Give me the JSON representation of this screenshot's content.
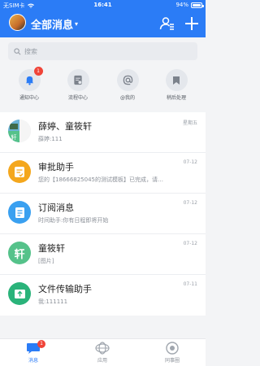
{
  "status_bar": {
    "carrier": "无SIM卡",
    "time": "16:41",
    "battery": "94%"
  },
  "header": {
    "title": "全部消息"
  },
  "search": {
    "placeholder": "搜索"
  },
  "shortcuts": [
    {
      "label": "通知中心",
      "badge": "1",
      "icon": "bell-icon"
    },
    {
      "label": "流程中心",
      "badge": "",
      "icon": "document-icon"
    },
    {
      "label": "@我的",
      "badge": "",
      "icon": "at-icon"
    },
    {
      "label": "稍后处理",
      "badge": "",
      "icon": "bookmark-icon"
    }
  ],
  "conversations": [
    {
      "name": "薛婷、童筱轩",
      "preview": "薛婷:111",
      "time": "星期五",
      "icon": "group-avatar"
    },
    {
      "name": "审批助手",
      "preview": "您的【18666825045的测试模板】已完成，请…",
      "time": "07-12",
      "icon": "approval-icon",
      "color": "#f4a71d"
    },
    {
      "name": "订阅消息",
      "preview": "时间助手:你有日程即将开始",
      "time": "07-12",
      "icon": "subscription-icon",
      "color": "#3aa0f0"
    },
    {
      "name": "童筱轩",
      "preview": "[图片]",
      "time": "07-12",
      "icon": "user-avatar",
      "initial": "轩",
      "color": "#55c28a"
    },
    {
      "name": "文件传输助手",
      "preview": "我:111111",
      "time": "07-11",
      "icon": "file-transfer-icon",
      "color": "#2ab37a"
    }
  ],
  "tabs": [
    {
      "label": "消息",
      "badge": "1"
    },
    {
      "label": "应用",
      "badge": ""
    },
    {
      "label": "同事圈",
      "badge": ""
    }
  ],
  "colors": {
    "primary": "#2b7cf6",
    "badge": "#f04438"
  }
}
